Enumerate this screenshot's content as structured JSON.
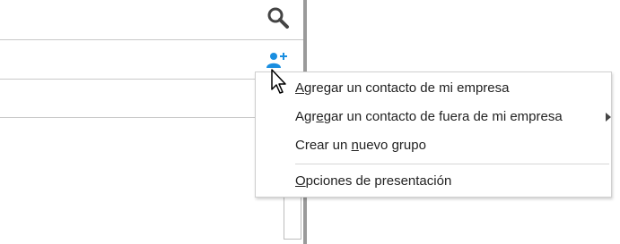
{
  "toolbar": {
    "search_icon": "search-icon",
    "add_contact_icon": "add-contact-icon"
  },
  "context_menu": {
    "items": [
      {
        "before": "",
        "mnemonic": "A",
        "after": "gregar un contacto de mi empresa",
        "has_submenu": false
      },
      {
        "before": "Agr",
        "mnemonic": "e",
        "after": "gar un contacto de fuera de mi empresa",
        "has_submenu": true
      },
      {
        "before": "Crear un ",
        "mnemonic": "n",
        "after": "uevo grupo",
        "has_submenu": false
      },
      {
        "before": "",
        "mnemonic": "O",
        "after": "pciones de presentación",
        "has_submenu": false
      }
    ]
  },
  "colors": {
    "accent": "#1a8ee0",
    "divider": "#9a9a9a",
    "line": "#c8c8c8",
    "text": "#222222"
  }
}
